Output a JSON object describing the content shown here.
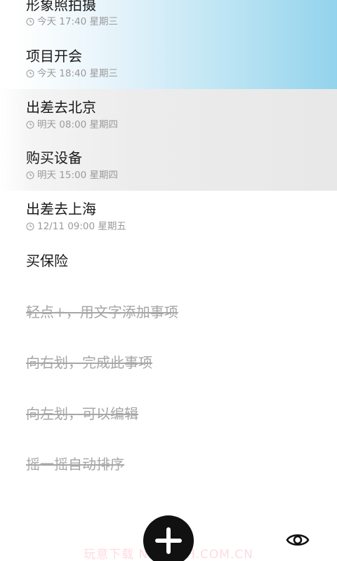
{
  "tasks": [
    {
      "title": "形象照拍摄",
      "time": "今天 17:40 星期三",
      "style": "blue"
    },
    {
      "title": "项目开会",
      "time": "今天 18:40 星期三",
      "style": "blue"
    },
    {
      "title": "出差去北京",
      "time": "明天 08:00 星期四",
      "style": "gray"
    },
    {
      "title": "购买设备",
      "time": "明天 15:00 星期四",
      "style": "gray"
    },
    {
      "title": "出差去上海",
      "time": "12/11 09:00 星期五",
      "style": "white"
    },
    {
      "title": "买保险",
      "time": "",
      "style": "white"
    }
  ],
  "hints": [
    {
      "title": "轻点+，用文字添加事项"
    },
    {
      "title": "向右划，完成此事项"
    },
    {
      "title": "向左划，可以编辑"
    },
    {
      "title": "摇一摇自动排序"
    }
  ],
  "bottom_bar": {
    "add_icon": "plus-icon",
    "toggle_icon": "eye-icon",
    "watermark": "玩意下载 NBWYXH.COM.CN"
  },
  "colors": {
    "highlight_blue": "#93d3ec",
    "highlight_gray": "#e8e8e8",
    "hint_text": "#a6a6a6",
    "primary_text": "#1a1a1a",
    "meta_text": "#9a9a9a",
    "fab": "#111111"
  }
}
